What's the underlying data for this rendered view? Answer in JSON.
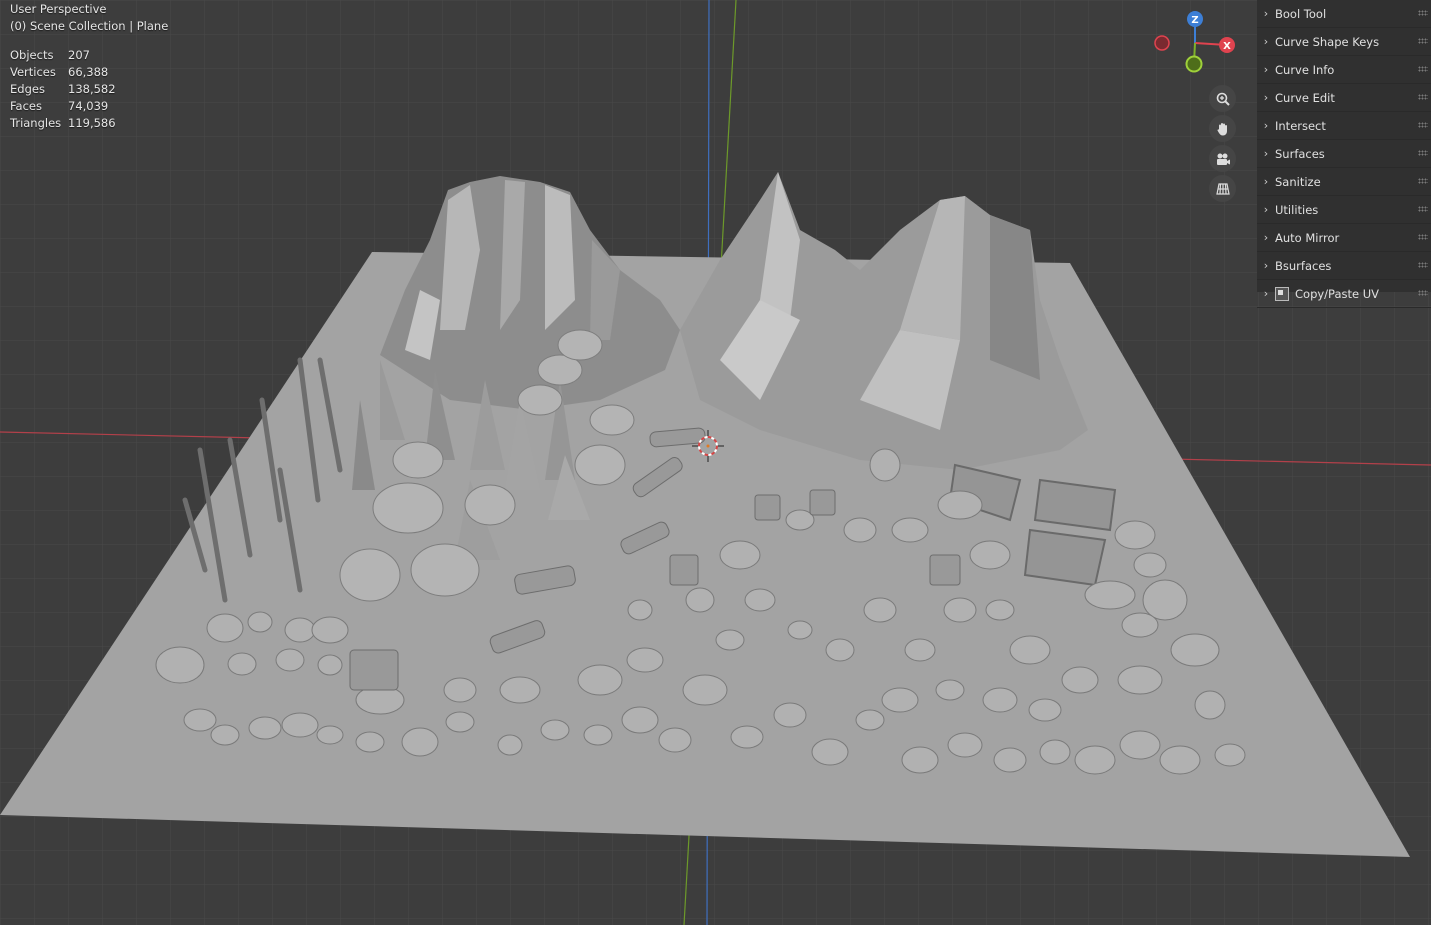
{
  "viewport": {
    "view_name": "User Perspective",
    "collection_label": "(0) Scene Collection | Plane"
  },
  "stats": [
    {
      "label": "Objects",
      "value": "207"
    },
    {
      "label": "Vertices",
      "value": "66,388"
    },
    {
      "label": "Edges",
      "value": "138,582"
    },
    {
      "label": "Faces",
      "value": "74,039"
    },
    {
      "label": "Triangles",
      "value": "119,586"
    }
  ],
  "gizmo": {
    "z_label": "Z",
    "x_label": "X"
  },
  "nav_icons": [
    "zoom-icon",
    "hand-pan-icon",
    "camera-icon",
    "grid-ortho-icon"
  ],
  "sidebar": {
    "panels": [
      {
        "label": "Bool Tool"
      },
      {
        "label": "Curve Shape Keys"
      },
      {
        "label": "Curve Info"
      },
      {
        "label": "Curve Edit"
      },
      {
        "label": "Intersect"
      },
      {
        "label": "Surfaces"
      },
      {
        "label": "Sanitize"
      },
      {
        "label": "Utilities"
      },
      {
        "label": "Auto Mirror"
      },
      {
        "label": "Bsurfaces"
      },
      {
        "label": "Copy/Paste UV"
      }
    ]
  },
  "colors": {
    "background": "#3d3d3d",
    "grid": "#4a4a4a",
    "plane": "#a3a3a3",
    "x_axis": "#b3404a",
    "y_axis": "#6d9a2a",
    "z_axis": "#3f6fbf",
    "sidebar": "#303030",
    "gizmo_x": "#e0434f",
    "gizmo_z": "#3d7fd6",
    "gizmo_y": "#7fb22a"
  }
}
